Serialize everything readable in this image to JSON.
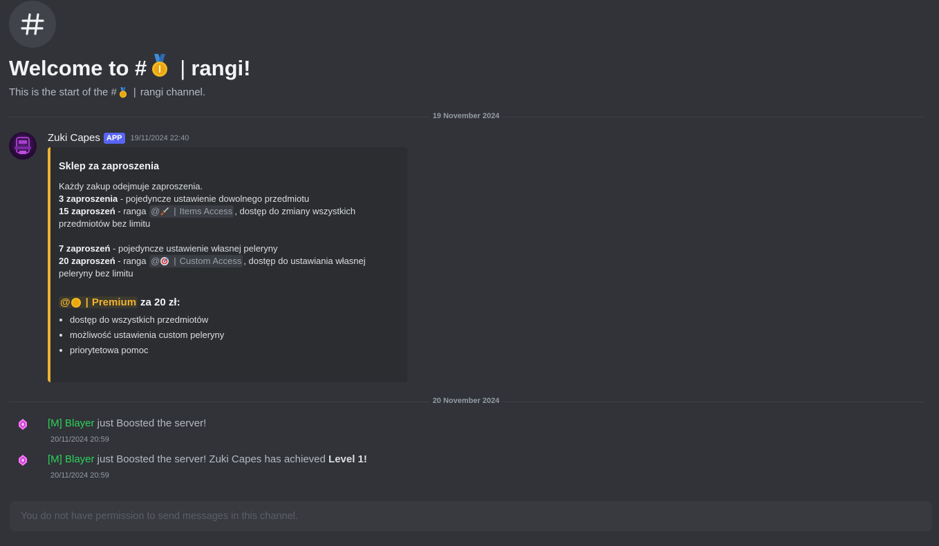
{
  "channel": {
    "welcome_prefix": "Welcome to #",
    "name": "rangi!",
    "subtitle_prefix": "This is the start of the #",
    "subtitle_suffix": "rangi channel.",
    "separator": "|"
  },
  "date_dividers": [
    "19 November 2024",
    "20 November 2024"
  ],
  "message": {
    "author": "Zuki Capes",
    "badge": "APP",
    "timestamp": "19/11/2024 22:40",
    "embed": {
      "accent_color": "#f0b232",
      "title": "Sklep za zaproszenia",
      "intro": "Każdy zakup odejmuje zaproszenia.",
      "item1_bold": "3 zaproszenia",
      "item1_text": " - pojedyncze ustawienie dowolnego przedmiotu",
      "item2_bold": "15 zaproszeń",
      "item2_pre": " - ranga ",
      "items_access_at": "@",
      "items_access_label": "Items Access",
      "item2_post": ", dostęp do zmiany wszystkich przedmiotów bez limitu",
      "item3_bold": "7 zaproszeń",
      "item3_text": " - pojedyncze ustawienie własnej peleryny",
      "item4_bold": "20 zaproszeń",
      "item4_pre": " - ranga ",
      "custom_access_at": "@",
      "custom_access_label": "Custom Access",
      "item4_post": ", dostęp do ustawiania własnej peleryny bez limitu",
      "premium_at": "@",
      "premium_label": "Premium",
      "premium_price": "za 20 zł:",
      "bullets": [
        "dostęp do wszystkich przedmiotów",
        "możliwość ustawienia custom peleryny",
        "priorytetowa pomoc"
      ]
    }
  },
  "boosts": [
    {
      "user": "[M] Blayer",
      "text": " just Boosted the server!",
      "extra_text": "",
      "extra_bold": "",
      "time": "20/11/2024 20:59"
    },
    {
      "user": "[M] Blayer",
      "text": " just Boosted the server! Zuki Capes has achieved ",
      "extra_text": "",
      "extra_bold": "Level 1!",
      "time": "20/11/2024 20:59"
    }
  ],
  "input": {
    "placeholder": "You do not have permission to send messages in this channel."
  },
  "icons": {
    "channel": "hash-icon",
    "medal": "first-place-medal-icon",
    "dagger": "dagger-icon",
    "target": "target-icon",
    "coin": "coin-icon",
    "boost": "nitro-boost-gem-icon"
  }
}
